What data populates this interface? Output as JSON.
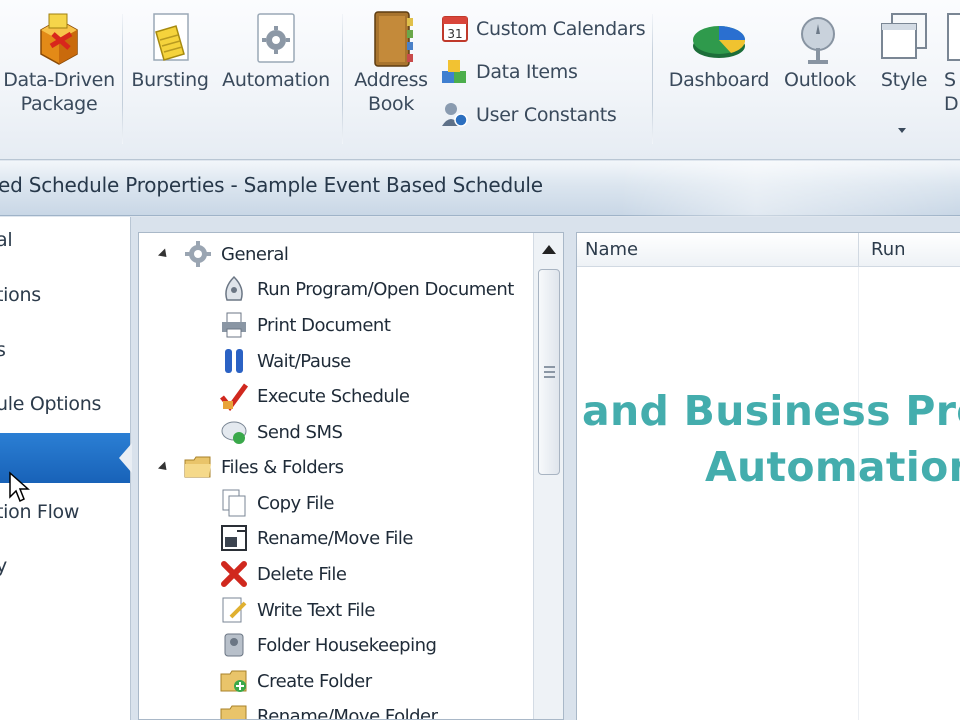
{
  "ribbon": {
    "data_driven_label_1": "Data-Driven",
    "data_driven_label_2": "Package",
    "bursting_label": "Bursting",
    "automation_label": "Automation",
    "address_book_label_1": "Address",
    "address_book_label_2": "Book",
    "custom_calendars_label": "Custom Calendars",
    "data_items_label": "Data Items",
    "user_constants_label": "User Constants",
    "dashboard_label": "Dashboard",
    "outlook_label": "Outlook",
    "style_label": "Style",
    "partial_label_1": "S",
    "partial_label_2": "D"
  },
  "window": {
    "title": "ed Schedule Properties - Sample Event Based Schedule"
  },
  "leftnav": {
    "items": [
      "al",
      "tions",
      "s",
      "ule Options",
      "",
      "tion Flow",
      "y"
    ]
  },
  "tree": {
    "groups": [
      {
        "label": "General",
        "items": [
          "Run Program/Open Document",
          "Print Document",
          "Wait/Pause",
          "Execute Schedule",
          "Send SMS"
        ]
      },
      {
        "label": "Files & Folders",
        "items": [
          "Copy File",
          "Rename/Move File",
          "Delete File",
          "Write Text File",
          "Folder Housekeeping",
          "Create Folder",
          "Rename/Move Folder"
        ]
      }
    ]
  },
  "list": {
    "columns": [
      "Name",
      "Run"
    ]
  },
  "overlay": {
    "line1": "and Business Pro",
    "line2": "Automation"
  },
  "icons": {
    "data_driven": "package-box-icon",
    "bursting": "burst-document-icon",
    "automation": "gear-document-icon",
    "address_book": "address-book-icon",
    "custom_calendars": "calendar-icon",
    "data_items": "data-items-icon",
    "user_constants": "user-constants-icon",
    "dashboard": "pie-chart-icon",
    "outlook": "outlook-icon",
    "style": "style-windows-icon"
  }
}
